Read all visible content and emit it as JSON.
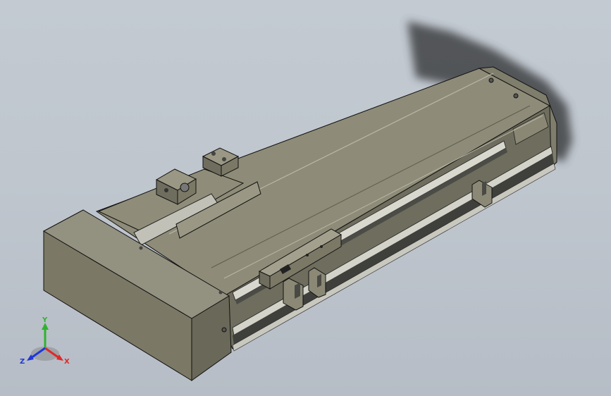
{
  "viewport": {
    "background": "#bfc6ce",
    "model_colors": {
      "body_top": "#8e8c78",
      "body_side": "#6f6d5d",
      "body_front": "#7b7966",
      "rail": "#bdbcb4",
      "rail_dark": "#5a5a54",
      "shadow": "#46484b",
      "edge": "#111111"
    }
  },
  "triad": {
    "labels": {
      "x": "X",
      "y": "Y",
      "z": "Z"
    },
    "colors": {
      "x": "#e0282b",
      "y": "#2fb32f",
      "z": "#2136d8"
    }
  }
}
